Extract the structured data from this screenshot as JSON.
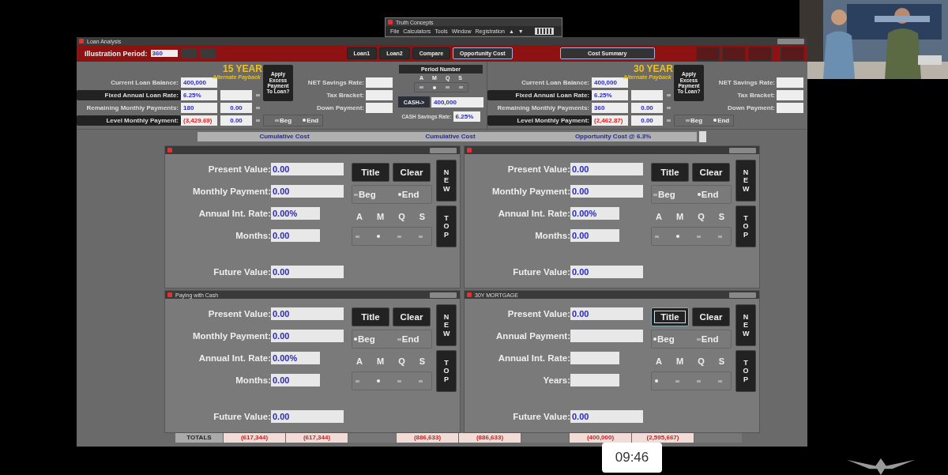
{
  "app_window": {
    "title": "Truth Concepts",
    "menu": [
      "File",
      "Calculators",
      "Tools",
      "Window",
      "Registration",
      "▲",
      "▼"
    ]
  },
  "loan_window": {
    "title": "Loan Analysis",
    "period_label": "Illustration Period:",
    "period_value": "360",
    "tabs": [
      {
        "label": "Loan1",
        "selected": false
      },
      {
        "label": "Loan2",
        "selected": false
      },
      {
        "label": "Compare",
        "selected": false
      },
      {
        "label": "Opportunity Cost",
        "selected": true
      }
    ],
    "summary_button": "Cost Summary",
    "loans": [
      {
        "heading": "15 YEAR",
        "alt_heading": "Alternate Payback",
        "apply_button": "Apply Excess Payment To Loan?",
        "fields": [
          {
            "label": "Current Loan Balance:",
            "value": "400,000",
            "kind": "plain"
          },
          {
            "label": "Fixed Annual Loan Rate:",
            "value": "6.25%",
            "kind": "button"
          },
          {
            "label": "Remaining  Monthly Payments:",
            "value": "180",
            "alt": "0.00",
            "kind": "plain"
          },
          {
            "label": "Level Monthly Payment:",
            "value": "(3,429.69)",
            "alt": "0.00",
            "kind": "button",
            "negative": true
          }
        ],
        "side_fields": [
          "NET Savings Rate:",
          "Tax Bracket:",
          "Down Payment:"
        ],
        "timing": [
          {
            "label": "Beg",
            "selected": false
          },
          {
            "label": "End",
            "selected": true
          }
        ]
      },
      {
        "heading": "30 YEAR",
        "alt_heading": "Alternate Payback",
        "apply_button": "Apply Excess Payment To Loan?",
        "fields": [
          {
            "label": "Current Loan Balance:",
            "value": "400,000",
            "kind": "plain"
          },
          {
            "label": "Fixed Annual Loan Rate:",
            "value": "6.25%",
            "kind": "button"
          },
          {
            "label": "Remaining  Monthly Payments:",
            "value": "360",
            "alt": "0.00",
            "kind": "plain"
          },
          {
            "label": "Level Monthly Payment:",
            "value": "(2,462.87)",
            "alt": "0.00",
            "kind": "button",
            "negative": true
          }
        ],
        "side_fields": [
          "NET Savings Rate:",
          "Tax Bracket:",
          "Down Payment:"
        ],
        "timing": [
          {
            "label": "Beg",
            "selected": false
          },
          {
            "label": "End",
            "selected": true
          }
        ]
      }
    ],
    "center": {
      "period_button": "Period Number",
      "frequency": [
        {
          "label": "A",
          "selected": false
        },
        {
          "label": "M",
          "selected": true
        },
        {
          "label": "Q",
          "selected": false
        },
        {
          "label": "S",
          "selected": false
        }
      ],
      "cash_label": "CASH->",
      "cash_value": "400,000",
      "rate_label": "CASH Savings Rate:",
      "rate_value": "6.25%"
    },
    "table": {
      "headers": [
        "Cumulative Cost",
        "Cumulative Cost",
        "Opportunity Cost @ 6.3%"
      ],
      "totals_label": "TOTALS",
      "totals": [
        [
          "(617,344)",
          "(617,344)"
        ],
        [
          "(886,633)",
          "(886,633)"
        ],
        [
          "(400,000)",
          "(2,595,667)"
        ]
      ]
    }
  },
  "calculators": [
    {
      "fields": [
        {
          "label": "Present Value:",
          "value": "0.00"
        },
        {
          "label": "Monthly Payment:",
          "value": "0.00"
        },
        {
          "label": "Annual Int. Rate:",
          "value": "0.00%"
        },
        {
          "label": "Months:",
          "value": "0.00"
        },
        {
          "label": "Future Value:",
          "value": "0.00"
        }
      ],
      "buttons": [
        "Title",
        "Clear",
        "NEW",
        "TOP"
      ],
      "timing": [
        {
          "label": "Beg",
          "selected": false
        },
        {
          "label": "End",
          "selected": true
        }
      ],
      "frequency": [
        {
          "label": "A",
          "selected": false
        },
        {
          "label": "M",
          "selected": true
        },
        {
          "label": "Q",
          "selected": false
        },
        {
          "label": "S",
          "selected": false
        }
      ]
    },
    {
      "fields": [
        {
          "label": "Present Value:",
          "value": "0.00"
        },
        {
          "label": "Monthly Payment:",
          "value": "0.00"
        },
        {
          "label": "Annual Int. Rate:",
          "value": "0.00%"
        },
        {
          "label": "Months:",
          "value": "0.00"
        },
        {
          "label": "Future Value:",
          "value": "0.00"
        }
      ],
      "buttons": [
        "Title",
        "Clear",
        "NEW",
        "TOP"
      ],
      "timing": [
        {
          "label": "Beg",
          "selected": false
        },
        {
          "label": "End",
          "selected": true
        }
      ],
      "frequency": [
        {
          "label": "A",
          "selected": false
        },
        {
          "label": "M",
          "selected": true
        },
        {
          "label": "Q",
          "selected": false
        },
        {
          "label": "S",
          "selected": false
        }
      ]
    },
    {
      "title": "Paying with Cash",
      "fields": [
        {
          "label": "Present Value:",
          "value": "0.00"
        },
        {
          "label": "Monthly Payment:",
          "value": "0.00"
        },
        {
          "label": "Annual Int. Rate:",
          "value": "0.00%"
        },
        {
          "label": "Months:",
          "value": "0.00"
        },
        {
          "label": "Future Value:",
          "value": "0.00"
        }
      ],
      "buttons": [
        "Title",
        "Clear",
        "NEW",
        "TOP"
      ],
      "timing": [
        {
          "label": "Beg",
          "selected": true
        },
        {
          "label": "End",
          "selected": false
        }
      ],
      "frequency": [
        {
          "label": "A",
          "selected": false
        },
        {
          "label": "M",
          "selected": true
        },
        {
          "label": "Q",
          "selected": false
        },
        {
          "label": "S",
          "selected": false
        }
      ]
    },
    {
      "title": "30Y MORTGAGE",
      "focused_title_button": true,
      "fields": [
        {
          "label": "Present Value:",
          "value": "0.00"
        },
        {
          "label": "Annual Payment:"
        },
        {
          "label": "Annual Int. Rate:"
        },
        {
          "label": "Years:"
        },
        {
          "label": "Future Value:",
          "value": "0.00"
        }
      ],
      "buttons": [
        "Title",
        "Clear",
        "NEW",
        "TOP"
      ],
      "timing": [
        {
          "label": "Beg",
          "selected": true
        },
        {
          "label": "End",
          "selected": false
        }
      ],
      "frequency": [
        {
          "label": "A",
          "selected": true
        },
        {
          "label": "M",
          "selected": false
        },
        {
          "label": "Q",
          "selected": false
        },
        {
          "label": "S",
          "selected": false
        }
      ]
    }
  ],
  "timestamp": "09:46"
}
